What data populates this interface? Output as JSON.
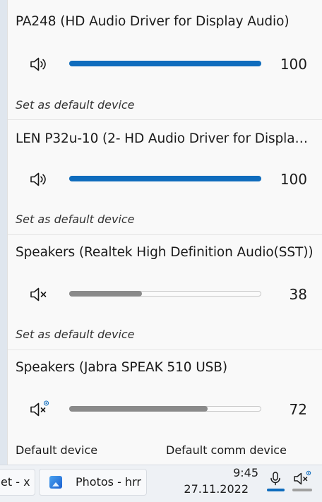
{
  "devices": [
    {
      "name": "PA248 (HD Audio Driver for Display Audio)",
      "icon": "speaker-icon",
      "volume": 100,
      "volume_text": "100",
      "fill_color": "#0f6cbd",
      "action": "Set as default device"
    },
    {
      "name": "LEN P32u-10 (2- HD Audio Driver for Displa…",
      "icon": "speaker-icon",
      "volume": 100,
      "volume_text": "100",
      "fill_color": "#0f6cbd",
      "action": "Set as default device"
    },
    {
      "name": "Speakers (Realtek High Definition Audio(SST))",
      "icon": "speaker-muted-icon",
      "volume": 38,
      "volume_text": "38",
      "fill_color": "#8a8a8a",
      "action": "Set as default device"
    },
    {
      "name": "Speakers (Jabra SPEAK 510 USB)",
      "icon": "speaker-muted-comm-icon",
      "volume": 72,
      "volume_text": "72",
      "fill_color": "#8a8a8a",
      "status_default": "Default device",
      "status_comm": "Default comm device"
    }
  ],
  "taskbar": {
    "app1_label": "et - x",
    "app2_label": "Photos - hrr",
    "time": "9:45",
    "date": "27.11.2022",
    "mic_underline_color": "#0f6cbd",
    "speaker_underline_color": "#a0a0a0"
  },
  "colors": {
    "accent": "#0f6cbd",
    "muted_fill": "#8a8a8a"
  }
}
